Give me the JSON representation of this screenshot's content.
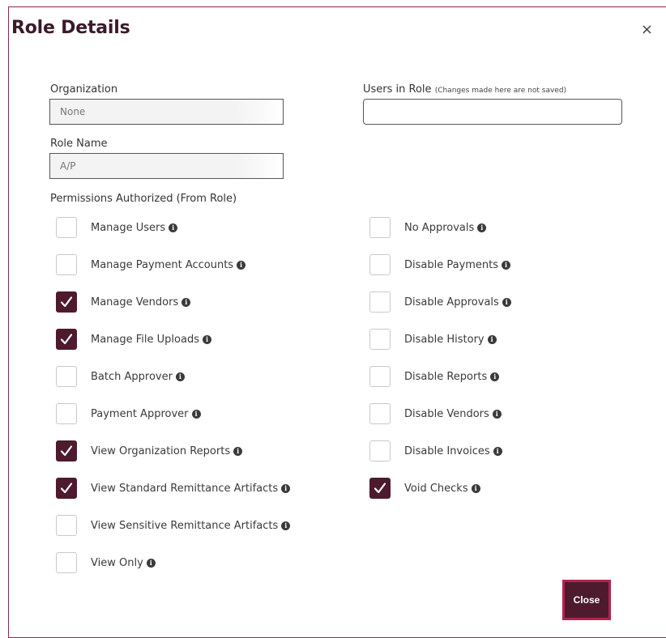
{
  "dialog": {
    "title": "Role Details",
    "close_icon": "×",
    "close_button_label": "Close"
  },
  "organization": {
    "label": "Organization",
    "value": "None"
  },
  "users_in_role": {
    "label": "Users in Role",
    "note": "(Changes made here are not saved)",
    "value": ""
  },
  "role_name": {
    "label": "Role Name",
    "value": "A/P"
  },
  "permissions": {
    "heading": "Permissions Authorized  (From Role)",
    "left": [
      {
        "label": "Manage Users",
        "checked": false
      },
      {
        "label": "Manage Payment Accounts",
        "checked": false
      },
      {
        "label": "Manage Vendors",
        "checked": true
      },
      {
        "label": "Manage File Uploads",
        "checked": true
      },
      {
        "label": "Batch Approver",
        "checked": false
      },
      {
        "label": "Payment Approver",
        "checked": false
      },
      {
        "label": "View Organization Reports",
        "checked": true
      },
      {
        "label": "View Standard Remittance Artifacts",
        "checked": true
      },
      {
        "label": "View Sensitive Remittance Artifacts",
        "checked": false
      },
      {
        "label": "View Only",
        "checked": false
      }
    ],
    "right": [
      {
        "label": "No Approvals",
        "checked": false
      },
      {
        "label": "Disable Payments",
        "checked": false
      },
      {
        "label": "Disable Approvals",
        "checked": false
      },
      {
        "label": "Disable History",
        "checked": false
      },
      {
        "label": "Disable Reports",
        "checked": false
      },
      {
        "label": "Disable Vendors",
        "checked": false
      },
      {
        "label": "Disable Invoices",
        "checked": false
      },
      {
        "label": "Void Checks",
        "checked": true
      }
    ]
  },
  "colors": {
    "accent": "#4d1a2e",
    "border_accent": "#b3234e"
  }
}
